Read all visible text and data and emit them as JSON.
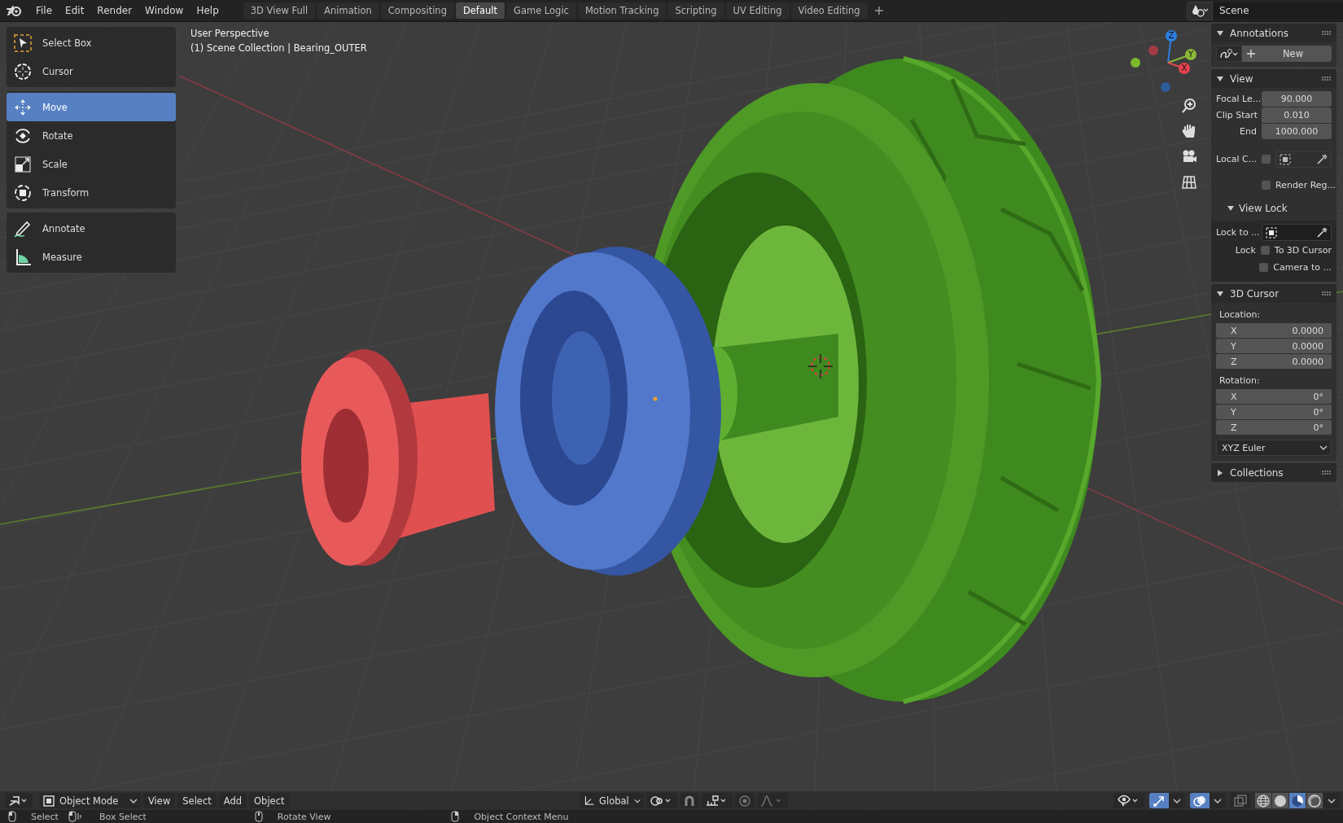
{
  "menu_bar": {
    "menus": [
      "File",
      "Edit",
      "Render",
      "Window",
      "Help"
    ]
  },
  "workspace_tabs": [
    {
      "label": "3D View Full",
      "selected": false
    },
    {
      "label": "Animation",
      "selected": false
    },
    {
      "label": "Compositing",
      "selected": false
    },
    {
      "label": "Default",
      "selected": true
    },
    {
      "label": "Game Logic",
      "selected": false
    },
    {
      "label": "Motion Tracking",
      "selected": false
    },
    {
      "label": "Scripting",
      "selected": false
    },
    {
      "label": "UV Editing",
      "selected": false
    },
    {
      "label": "Video Editing",
      "selected": false
    }
  ],
  "scene_selector": {
    "name": "Scene"
  },
  "viewport": {
    "overlay_text": [
      "User Perspective",
      "(1) Scene Collection | Bearing_OUTER"
    ],
    "tool_groups": [
      [
        {
          "label": "Select Box",
          "kind": "select_box",
          "selected": false
        },
        {
          "label": "Cursor",
          "kind": "cursor",
          "selected": false
        }
      ],
      [
        {
          "label": "Move",
          "kind": "move",
          "selected": true
        },
        {
          "label": "Rotate",
          "kind": "rotate",
          "selected": false
        },
        {
          "label": "Scale",
          "kind": "scale",
          "selected": false
        },
        {
          "label": "Transform",
          "kind": "transform",
          "selected": false
        }
      ],
      [
        {
          "label": "Annotate",
          "kind": "annotate",
          "selected": false
        },
        {
          "label": "Measure",
          "kind": "measure",
          "selected": false
        }
      ]
    ],
    "gizmo_axes": [
      {
        "label": "Z",
        "color": "#2c7fe0"
      },
      {
        "label": "Y",
        "color": "#8bb83a"
      },
      {
        "label": "X",
        "color": "#e8424f"
      }
    ]
  },
  "header": {
    "mode": "Object Mode",
    "menus": [
      "View",
      "Select",
      "Add",
      "Object"
    ],
    "orientation": "Global",
    "toggles": [
      {
        "kind": "gizmo",
        "on": true
      },
      {
        "kind": "overlay",
        "on": true
      },
      {
        "kind": "xray",
        "on": false
      }
    ],
    "shading": [
      {
        "kind": "wireframe",
        "selected": false
      },
      {
        "kind": "solid",
        "selected": false
      },
      {
        "kind": "material",
        "selected": true
      },
      {
        "kind": "rendered",
        "selected": false
      }
    ]
  },
  "sidebar": {
    "panels": [
      {
        "kind": "annotations",
        "title": "Annotations",
        "expanded": true,
        "button": "New"
      },
      {
        "kind": "view",
        "title": "View",
        "expanded": true,
        "fields": [
          {
            "label": "Focal Le...",
            "value": "90.000"
          },
          {
            "label": "Clip Start",
            "value": "0.010"
          },
          {
            "label": "End",
            "value": "1000.000"
          }
        ],
        "local_camera": {
          "label": "Local C...",
          "checked": false
        },
        "render_region": {
          "label": "Render Reg...",
          "checked": false
        },
        "view_lock": {
          "title": "View Lock",
          "expanded": true,
          "lock_to_label": "Lock to ...",
          "lock_label": "Lock",
          "options": [
            {
              "label": "To 3D Cursor",
              "checked": false
            },
            {
              "label": "Camera to ...",
              "checked": false
            }
          ]
        }
      },
      {
        "kind": "cursor3d",
        "title": "3D Cursor",
        "expanded": true,
        "location_label": "Location:",
        "location": [
          {
            "axis": "X",
            "value": "0.0000"
          },
          {
            "axis": "Y",
            "value": "0.0000"
          },
          {
            "axis": "Z",
            "value": "0.0000"
          }
        ],
        "rotation_label": "Rotation:",
        "rotation": [
          {
            "axis": "X",
            "value": "0°"
          },
          {
            "axis": "Y",
            "value": "0°"
          },
          {
            "axis": "Z",
            "value": "0°"
          }
        ],
        "rotation_mode": "XYZ Euler"
      },
      {
        "title": "Collections",
        "expanded": false
      }
    ]
  },
  "status_bar": [
    {
      "label": "Select",
      "kind": "left"
    },
    {
      "label": "Box Select",
      "kind": "drag"
    },
    {
      "label": "Rotate View",
      "kind": "middle"
    },
    {
      "label": "Object Context Menu",
      "kind": "right"
    }
  ]
}
